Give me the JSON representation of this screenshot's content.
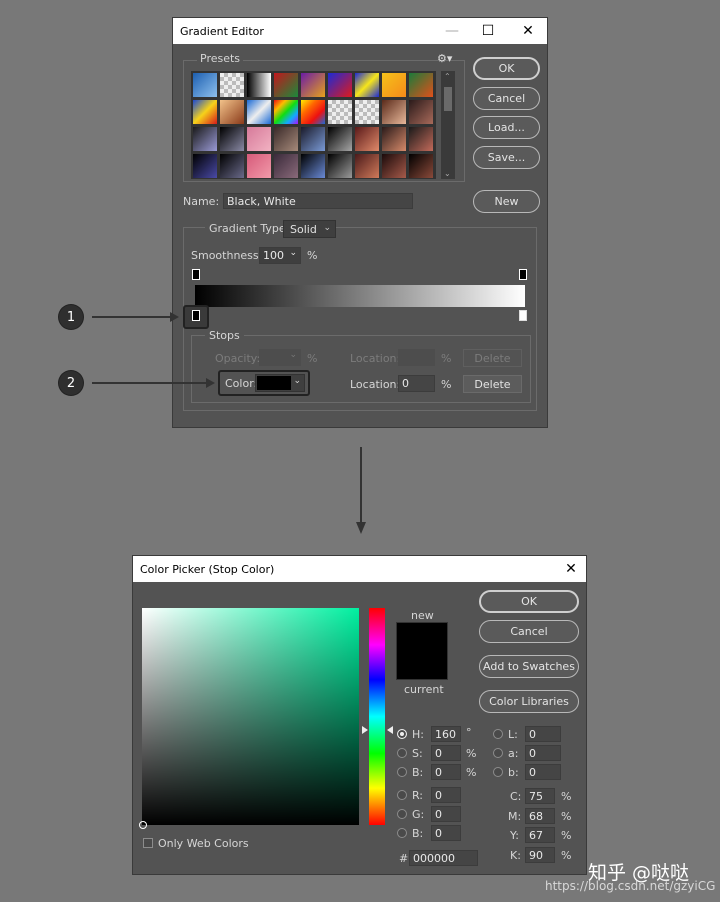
{
  "gradient_editor": {
    "title": "Gradient Editor",
    "presets_label": "Presets",
    "buttons": {
      "ok": "OK",
      "cancel": "Cancel",
      "load": "Load...",
      "save": "Save...",
      "new": "New"
    },
    "name_label": "Name:",
    "name_value": "Black, White",
    "gradient_type_label": "Gradient Type:",
    "gradient_type_value": "Solid",
    "smoothness_label": "Smoothness:",
    "smoothness_value": "100",
    "smoothness_unit": "%",
    "stops_label": "Stops",
    "opacity_label": "Opacity:",
    "opacity_unit": "%",
    "opacity_location_label": "Location:",
    "opacity_location_unit": "%",
    "opacity_delete": "Delete",
    "color_label": "Color:",
    "color_location_label": "Location:",
    "color_location_value": "0",
    "color_location_unit": "%",
    "color_delete": "Delete",
    "preset_swatches": [
      "linear-gradient(135deg,#1d5fb0,#8ec0ee)",
      "repeating-conic-gradient(#bbb 0 25%,#eee 0 50%) 0 0/8px 8px",
      "linear-gradient(90deg,#000,#fff)",
      "linear-gradient(135deg,#c2161c,#1a8a3a)",
      "linear-gradient(135deg,#6b1ca6,#e8a21a)",
      "linear-gradient(135deg,#1c2ad6,#e01a1a)",
      "linear-gradient(135deg,#1c2ad6,#f6e61a,#1c2ad6)",
      "linear-gradient(135deg,#f5c21a,#f58a1a)",
      "linear-gradient(135deg,#1a7a3a,#e0501a)",
      "linear-gradient(135deg,#1a4ad6,#f6d21a,#d61a1a)",
      "linear-gradient(135deg,#f2c28a,#8a3a1a)",
      "linear-gradient(135deg,#1a6ad6,#eee,#1a6ad6)",
      "linear-gradient(135deg,#e11,#fb0,#1d1,#1af,#a1f)",
      "linear-gradient(135deg,#fe0,#f60,#e11,#1a6ad6)",
      "repeating-conic-gradient(#bbb 0 25%,#eee 0 50%) 0 0/8px 8px",
      "repeating-conic-gradient(#bbb 0 25%,#eee 0 50%) 0 0/8px 8px",
      "linear-gradient(135deg,#5a2a1a,#e8b89a)",
      "linear-gradient(135deg,#2a1a1a,#a86a5a)",
      "linear-gradient(135deg,#1a1a1a,#9a9ad6)",
      "linear-gradient(135deg,#000,#8a8aa6)",
      "linear-gradient(135deg,#d67a9a,#f2b2c2)",
      "linear-gradient(135deg,#3a2a2a,#a68a7a)",
      "linear-gradient(135deg,#1a1a2a,#7a9ad6)",
      "linear-gradient(135deg,#000,#a6a6a6)",
      "linear-gradient(135deg,#5a1a1a,#e08a6a)",
      "linear-gradient(135deg,#2a1a1a,#d68a6a)",
      "linear-gradient(135deg,#1a1a1a,#c26a5a)",
      "linear-gradient(135deg,#000,#4a4aa6)",
      "linear-gradient(135deg,#000,#6a6a8a)",
      "linear-gradient(135deg,#d65a7a,#f29aaa)",
      "linear-gradient(135deg,#3a2a3a,#8a6a7a)",
      "linear-gradient(135deg,#000,#6a8ad6)",
      "linear-gradient(135deg,#000,#9a9a9a)",
      "linear-gradient(135deg,#4a1a1a,#d07a5a)",
      "linear-gradient(135deg,#1a0a0a,#a65a4a)",
      "linear-gradient(135deg,#000,#8a4a3a)"
    ]
  },
  "markers": {
    "one": "1",
    "two": "2"
  },
  "color_picker": {
    "title": "Color Picker (Stop Color)",
    "buttons": {
      "ok": "OK",
      "cancel": "Cancel",
      "add_to_swatches": "Add to Swatches",
      "color_libraries": "Color Libraries"
    },
    "new_label": "new",
    "current_label": "current",
    "hsb": {
      "h_label": "H:",
      "h_value": "160",
      "h_unit": "°",
      "s_label": "S:",
      "s_value": "0",
      "s_unit": "%",
      "b_label": "B:",
      "b_value": "0",
      "b_unit": "%"
    },
    "rgb": {
      "r_label": "R:",
      "r_value": "0",
      "g_label": "G:",
      "g_value": "0",
      "b_label": "B:",
      "b_value": "0"
    },
    "lab": {
      "l_label": "L:",
      "l_value": "0",
      "a_label": "a:",
      "a_value": "0",
      "b_label": "b:",
      "b_value": "0"
    },
    "cmyk": {
      "c_label": "C:",
      "c_value": "75",
      "m_label": "M:",
      "m_value": "68",
      "y_label": "Y:",
      "y_value": "67",
      "k_label": "K:",
      "k_value": "90",
      "unit": "%"
    },
    "hex_label": "#",
    "hex_value": "000000",
    "only_web_colors": "Only Web Colors",
    "field_hue_color": "#00f0a0",
    "new_color": "#000000",
    "current_color": "#000000"
  },
  "watermark": {
    "zhihu": "知乎 @哒哒",
    "url": "https://blog.csdn.net/gzyiCG"
  }
}
